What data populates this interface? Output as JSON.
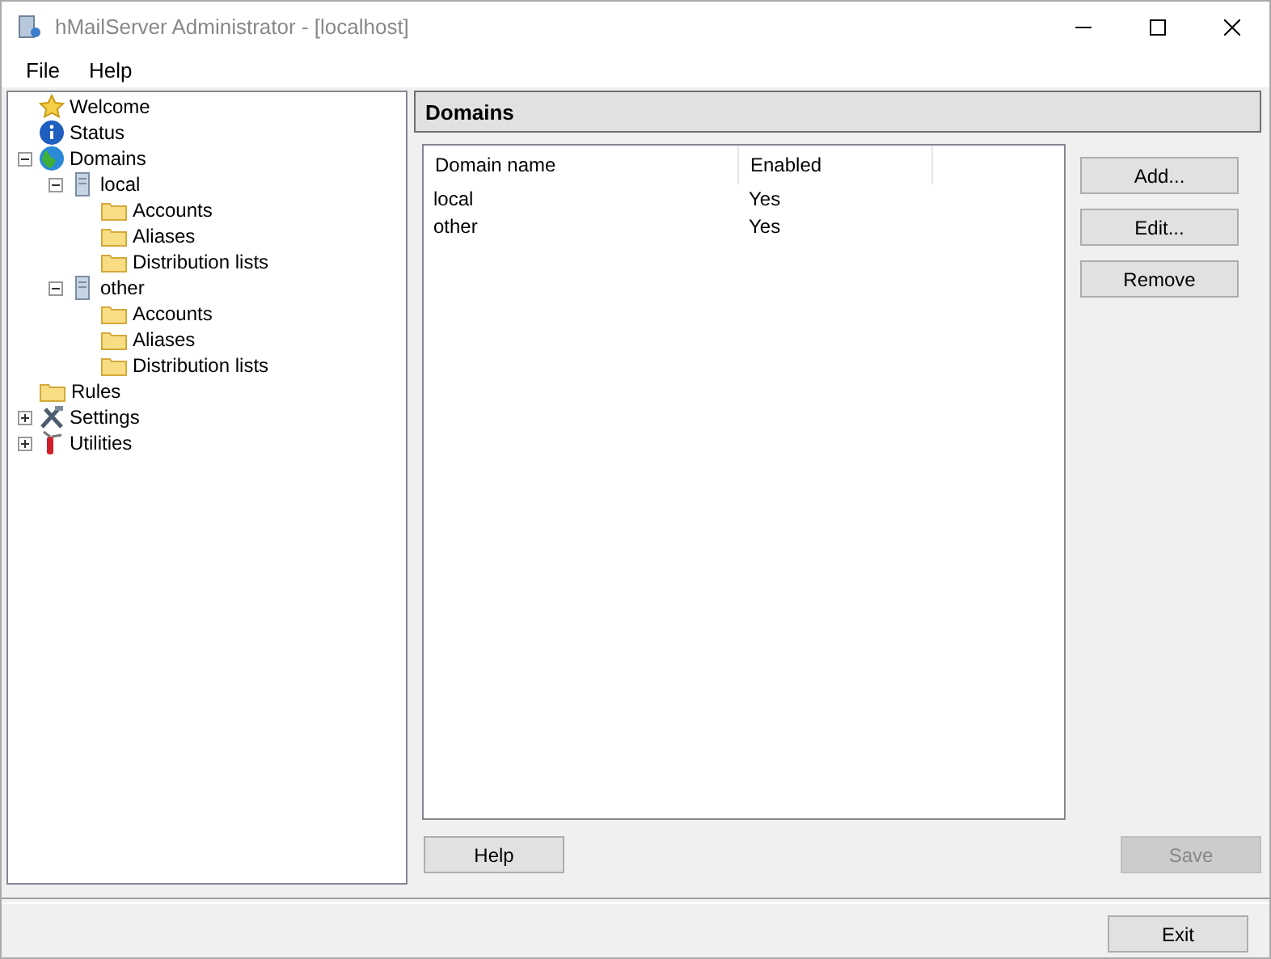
{
  "window": {
    "title": "hMailServer Administrator - [localhost]"
  },
  "menu": [
    "File",
    "Help"
  ],
  "tree": [
    {
      "label": "Welcome",
      "kind": "star"
    },
    {
      "label": "Status",
      "kind": "info"
    },
    {
      "label": "Domains",
      "kind": "globe",
      "expanded": true,
      "children": [
        {
          "label": "local",
          "kind": "server",
          "expanded": true,
          "children": [
            {
              "label": "Accounts",
              "kind": "folder"
            },
            {
              "label": "Aliases",
              "kind": "folder"
            },
            {
              "label": "Distribution lists",
              "kind": "folder"
            }
          ]
        },
        {
          "label": "other",
          "kind": "server",
          "expanded": true,
          "children": [
            {
              "label": "Accounts",
              "kind": "folder"
            },
            {
              "label": "Aliases",
              "kind": "folder"
            },
            {
              "label": "Distribution lists",
              "kind": "folder"
            }
          ]
        }
      ]
    },
    {
      "label": "Rules",
      "kind": "folder"
    },
    {
      "label": "Settings",
      "kind": "tools",
      "expanded": false
    },
    {
      "label": "Utilities",
      "kind": "knife",
      "expanded": false
    }
  ],
  "panel": {
    "title": "Domains",
    "table": {
      "columns": [
        "Domain name",
        "Enabled"
      ],
      "rows": [
        [
          "local",
          "Yes"
        ],
        [
          "other",
          "Yes"
        ]
      ]
    },
    "side_buttons": [
      {
        "label": "Add...",
        "disabled": false
      },
      {
        "label": "Edit...",
        "disabled": false
      },
      {
        "label": "Remove",
        "disabled": false
      }
    ],
    "help_button": {
      "label": "Help",
      "disabled": false
    },
    "save_button": {
      "label": "Save",
      "disabled": true
    }
  },
  "exit_button": {
    "label": "Exit",
    "disabled": false
  }
}
